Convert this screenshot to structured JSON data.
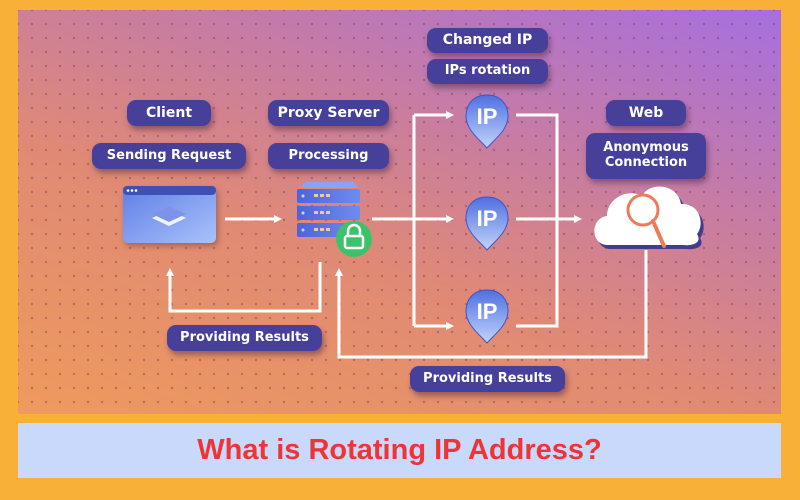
{
  "diagram": {
    "nodes": {
      "client": {
        "title": "Client",
        "subtitle": "Sending Request",
        "icon": "browser-window-icon"
      },
      "proxy": {
        "title": "Proxy Server",
        "subtitle": "Processing",
        "icon": "server-lock-icon"
      },
      "rotation": {
        "title": "Changed IP",
        "subtitle": "IPs rotation",
        "ip_labels": [
          "IP",
          "IP",
          "IP"
        ],
        "icon": "ip-pin-icon"
      },
      "web": {
        "title": "Web",
        "subtitle": "Anonymous Connection",
        "icon": "cloud-search-icon"
      }
    },
    "edges": [
      {
        "from": "client",
        "to": "proxy",
        "label": ""
      },
      {
        "from": "proxy",
        "to": "ip-1",
        "label": ""
      },
      {
        "from": "proxy",
        "to": "ip-2",
        "label": ""
      },
      {
        "from": "proxy",
        "to": "ip-3",
        "label": ""
      },
      {
        "from": "ip-rotation",
        "to": "web",
        "label": ""
      },
      {
        "from": "proxy",
        "to": "client",
        "label": "Providing Results"
      },
      {
        "from": "web",
        "to": "proxy",
        "label": "Providing Results"
      }
    ],
    "labels": {
      "results_client": "Providing Results",
      "results_web": "Providing Results"
    }
  },
  "banner": {
    "title": "What is Rotating IP Address?"
  },
  "colors": {
    "pill": "#46409a",
    "title_text": "#ee3434",
    "banner_bg": "#c9d9fb",
    "frame": "#f9b038",
    "lock": "#3cc36a"
  }
}
